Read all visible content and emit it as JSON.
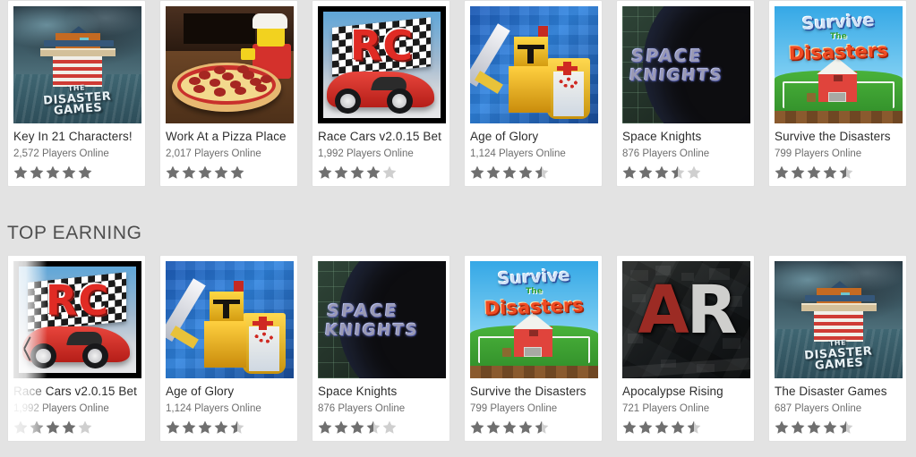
{
  "sections": [
    {
      "title": null,
      "name": "featured-row",
      "has_prev_arrow": false,
      "cards": [
        {
          "title": "Key In 21 Characters!",
          "players": "2,572 Players Online",
          "rating": 5,
          "art": "disaster",
          "dimmed": false
        },
        {
          "title": "Work At a Pizza Place",
          "players": "2,017 Players Online",
          "rating": 5,
          "art": "pizza",
          "dimmed": false
        },
        {
          "title": "Race Cars v2.0.15 Bet",
          "players": "1,992 Players Online",
          "rating": 4,
          "art": "rc",
          "dimmed": false
        },
        {
          "title": "Age of Glory",
          "players": "1,124 Players Online",
          "rating": 4.5,
          "art": "glory",
          "dimmed": false
        },
        {
          "title": "Space Knights",
          "players": "876 Players Online",
          "rating": 3.5,
          "art": "space",
          "dimmed": false
        },
        {
          "title": "Survive the Disasters",
          "players": "799 Players Online",
          "rating": 4.5,
          "art": "survive",
          "dimmed": false
        }
      ]
    },
    {
      "title": "TOP EARNING",
      "name": "top-earning-row",
      "has_prev_arrow": true,
      "prev_arrow_label": "‹",
      "cards": [
        {
          "title": "Race Cars v2.0.15 Bet",
          "players": "1,992 Players Online",
          "rating": 4,
          "art": "rc",
          "dimmed": true
        },
        {
          "title": "Age of Glory",
          "players": "1,124 Players Online",
          "rating": 4.5,
          "art": "glory",
          "dimmed": false
        },
        {
          "title": "Space Knights",
          "players": "876 Players Online",
          "rating": 3.5,
          "art": "space",
          "dimmed": false
        },
        {
          "title": "Survive the Disasters",
          "players": "799 Players Online",
          "rating": 4.5,
          "art": "survive",
          "dimmed": false
        },
        {
          "title": "Apocalypse Rising",
          "players": "721 Players Online",
          "rating": 4.5,
          "art": "ar",
          "dimmed": false
        },
        {
          "title": "The Disaster Games",
          "players": "687 Players Online",
          "rating": 4.5,
          "art": "disaster",
          "dimmed": false
        }
      ]
    }
  ],
  "art_text": {
    "disaster": {
      "line1": "THE",
      "line2": "DISASTER",
      "line3": "GAMES"
    },
    "rc": {
      "logo": "RC"
    },
    "space": {
      "line1": "SPACE",
      "line2": "KNIGHTS"
    },
    "survive": {
      "line1": "Survive",
      "line2": "The",
      "line3": "Disasters"
    },
    "ar": {
      "letter1": "A",
      "letter2": "R"
    }
  },
  "colors": {
    "page_background": "#e3e3e3",
    "card_background": "#ffffff",
    "title_text": "#2d2d2d",
    "players_text": "#6e6e6e",
    "section_title": "#4e4e4e",
    "star_filled": "#6f6f6f",
    "star_empty": "#cfcfcf"
  }
}
